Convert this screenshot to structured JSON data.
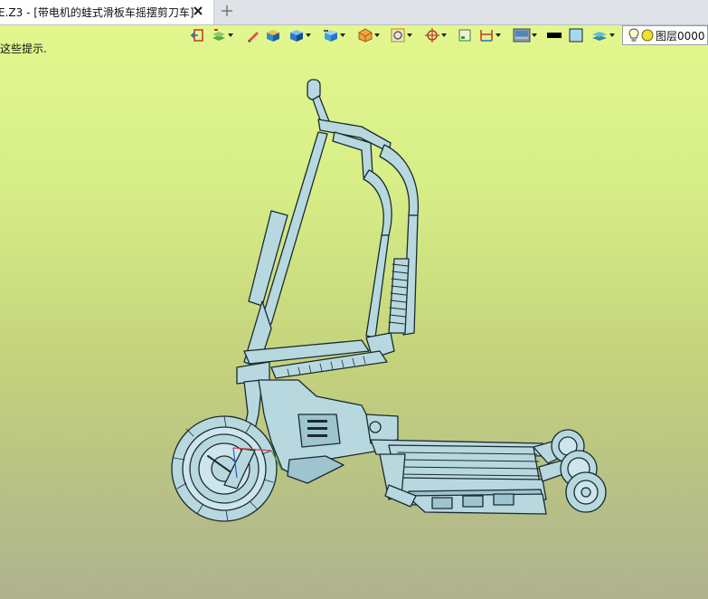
{
  "tab": {
    "title": "E.Z3 - [带电机的蛙式滑板车摇摆剪刀车]",
    "close_icon": "close-icon",
    "add_icon": "plus-icon"
  },
  "viewport": {
    "hint_text": "这些提示.",
    "background_top": "#e2f88e",
    "background_bottom": "#aeb28f"
  },
  "toolbar": {
    "layer_label": "图层0000",
    "color_swatch": "#000000",
    "fill_swatch": "#a8d8f0"
  },
  "model": {
    "line_color": "#1a2a30",
    "surface_color": "#b8d8e0"
  }
}
